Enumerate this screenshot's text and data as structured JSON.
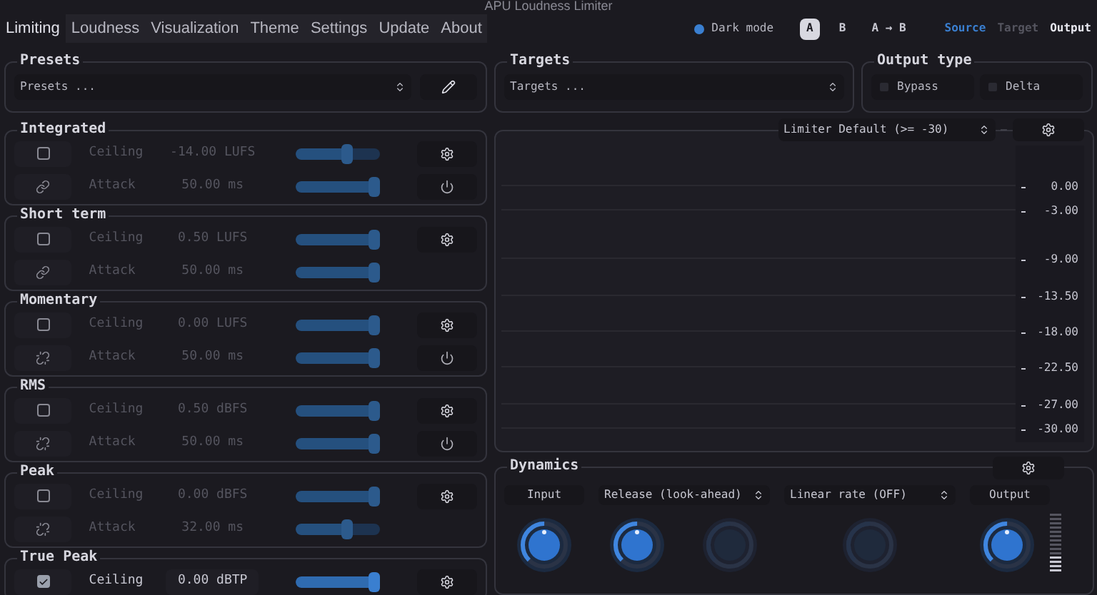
{
  "window": {
    "title": "APU Loudness Limiter"
  },
  "tabs": [
    {
      "label": "Limiting",
      "selected": true
    },
    {
      "label": "Loudness",
      "selected": false
    },
    {
      "label": "Visualization",
      "selected": false
    },
    {
      "label": "Theme",
      "selected": false
    },
    {
      "label": "Settings",
      "selected": false
    },
    {
      "label": "Update",
      "selected": false
    },
    {
      "label": "About",
      "selected": false
    }
  ],
  "dark_mode": {
    "label": "Dark mode",
    "on": true
  },
  "ab_buttons": [
    {
      "label": "A",
      "selected": true
    },
    {
      "label": "B",
      "selected": false
    },
    {
      "label": "A → B",
      "selected": false
    }
  ],
  "views": [
    {
      "label": "Source",
      "selected": true,
      "disabled": false
    },
    {
      "label": "Target",
      "selected": false,
      "disabled": true
    },
    {
      "label": "Output",
      "selected": false,
      "disabled": false
    }
  ],
  "presets": {
    "title": "Presets",
    "placeholder": "Presets ..."
  },
  "targets": {
    "title": "Targets",
    "placeholder": "Targets ..."
  },
  "output_type": {
    "title": "Output type",
    "options": [
      {
        "label": "Bypass",
        "checked": false
      },
      {
        "label": "Delta",
        "checked": false
      }
    ]
  },
  "groups": [
    {
      "title": "Integrated",
      "rows": [
        {
          "kind": "ceiling",
          "checked": false,
          "label": "Ceiling",
          "value": "-14.00 LUFS",
          "level": 0.6,
          "disabled": true
        },
        {
          "kind": "attack",
          "linked": true,
          "label": "Attack",
          "value": "50.00 ms",
          "level": 1,
          "reset": true,
          "disabled": true
        }
      ]
    },
    {
      "title": "Short term",
      "rows": [
        {
          "kind": "ceiling",
          "checked": false,
          "label": "Ceiling",
          "value": "0.50 LUFS",
          "level": 1,
          "disabled": true
        },
        {
          "kind": "attack",
          "linked": true,
          "label": "Attack",
          "value": "50.00 ms",
          "level": 1,
          "reset": false,
          "disabled": true
        }
      ]
    },
    {
      "title": "Momentary",
      "rows": [
        {
          "kind": "ceiling",
          "checked": false,
          "label": "Ceiling",
          "value": "0.00 LUFS",
          "level": 1,
          "disabled": true
        },
        {
          "kind": "attack",
          "linked": false,
          "label": "Attack",
          "value": "50.00 ms",
          "level": 1,
          "reset": true,
          "disabled": true
        }
      ]
    },
    {
      "title": "RMS",
      "rows": [
        {
          "kind": "ceiling",
          "checked": false,
          "label": "Ceiling",
          "value": "0.50 dBFS",
          "level": 1,
          "disabled": true
        },
        {
          "kind": "attack",
          "linked": false,
          "label": "Attack",
          "value": "50.00 ms",
          "level": 1,
          "reset": true,
          "disabled": true
        }
      ]
    },
    {
      "title": "Peak",
      "rows": [
        {
          "kind": "ceiling",
          "checked": false,
          "label": "Ceiling",
          "value": "0.00 dBFS",
          "level": 1,
          "disabled": true
        },
        {
          "kind": "attack",
          "linked": false,
          "label": "Attack",
          "value": "32.00 ms",
          "level": 0.6,
          "reset": false,
          "disabled": true
        }
      ]
    },
    {
      "title": "True Peak",
      "rows": [
        {
          "kind": "ceiling",
          "checked": true,
          "label": "Ceiling",
          "value": "0.00 dBTP",
          "level": 1,
          "disabled": false
        }
      ]
    }
  ],
  "graph": {
    "preset": "Limiter Default (>= -30)",
    "separator": "–",
    "scale": [
      "0.00",
      "-3.00",
      "-9.00",
      "-13.50",
      "-18.00",
      "-22.50",
      "-27.00",
      "-30.00"
    ]
  },
  "dynamics": {
    "title": "Dynamics",
    "controls": [
      {
        "kind": "label",
        "text": "Input"
      },
      {
        "kind": "select",
        "text": "Release (look-ahead)"
      },
      {
        "kind": "select",
        "text": "Linear rate (OFF)"
      },
      {
        "kind": "label",
        "text": "Output"
      }
    ],
    "knobs": [
      {
        "enabled": true
      },
      {
        "enabled": true
      },
      {
        "enabled": false
      },
      {
        "enabled": false
      },
      {
        "enabled": true
      }
    ]
  }
}
